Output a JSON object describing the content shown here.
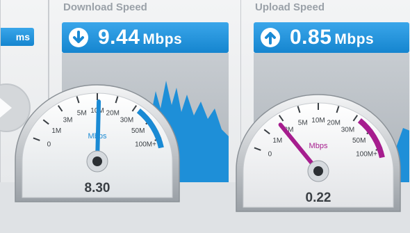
{
  "left_panel": {
    "button_label": "ms"
  },
  "download": {
    "title": "Download Speed",
    "value": "9.44",
    "unit": "Mbps",
    "graph_color": "#1e8fd8"
  },
  "upload": {
    "title": "Upload Speed",
    "value": "0.85",
    "unit": "Mbps",
    "graph_color": "#1e8fd8"
  },
  "download_gauge": {
    "reading": "8.30",
    "unit": "Mbps",
    "accent": "#1a8ad4",
    "ticks": [
      "0",
      "1M",
      "3M",
      "5M",
      "10M",
      "20M",
      "30M",
      "50M",
      "100M+"
    ],
    "needle_fraction": 0.51
  },
  "upload_gauge": {
    "reading": "0.22",
    "unit": "Mbps",
    "accent": "#a61d8e",
    "ticks": [
      "0",
      "1M",
      "3M",
      "5M",
      "10M",
      "20M",
      "30M",
      "50M",
      "100M+"
    ],
    "needle_fraction": 0.22
  },
  "icons": {
    "download": "arrow-down-circle-icon",
    "upload": "arrow-up-circle-icon"
  }
}
